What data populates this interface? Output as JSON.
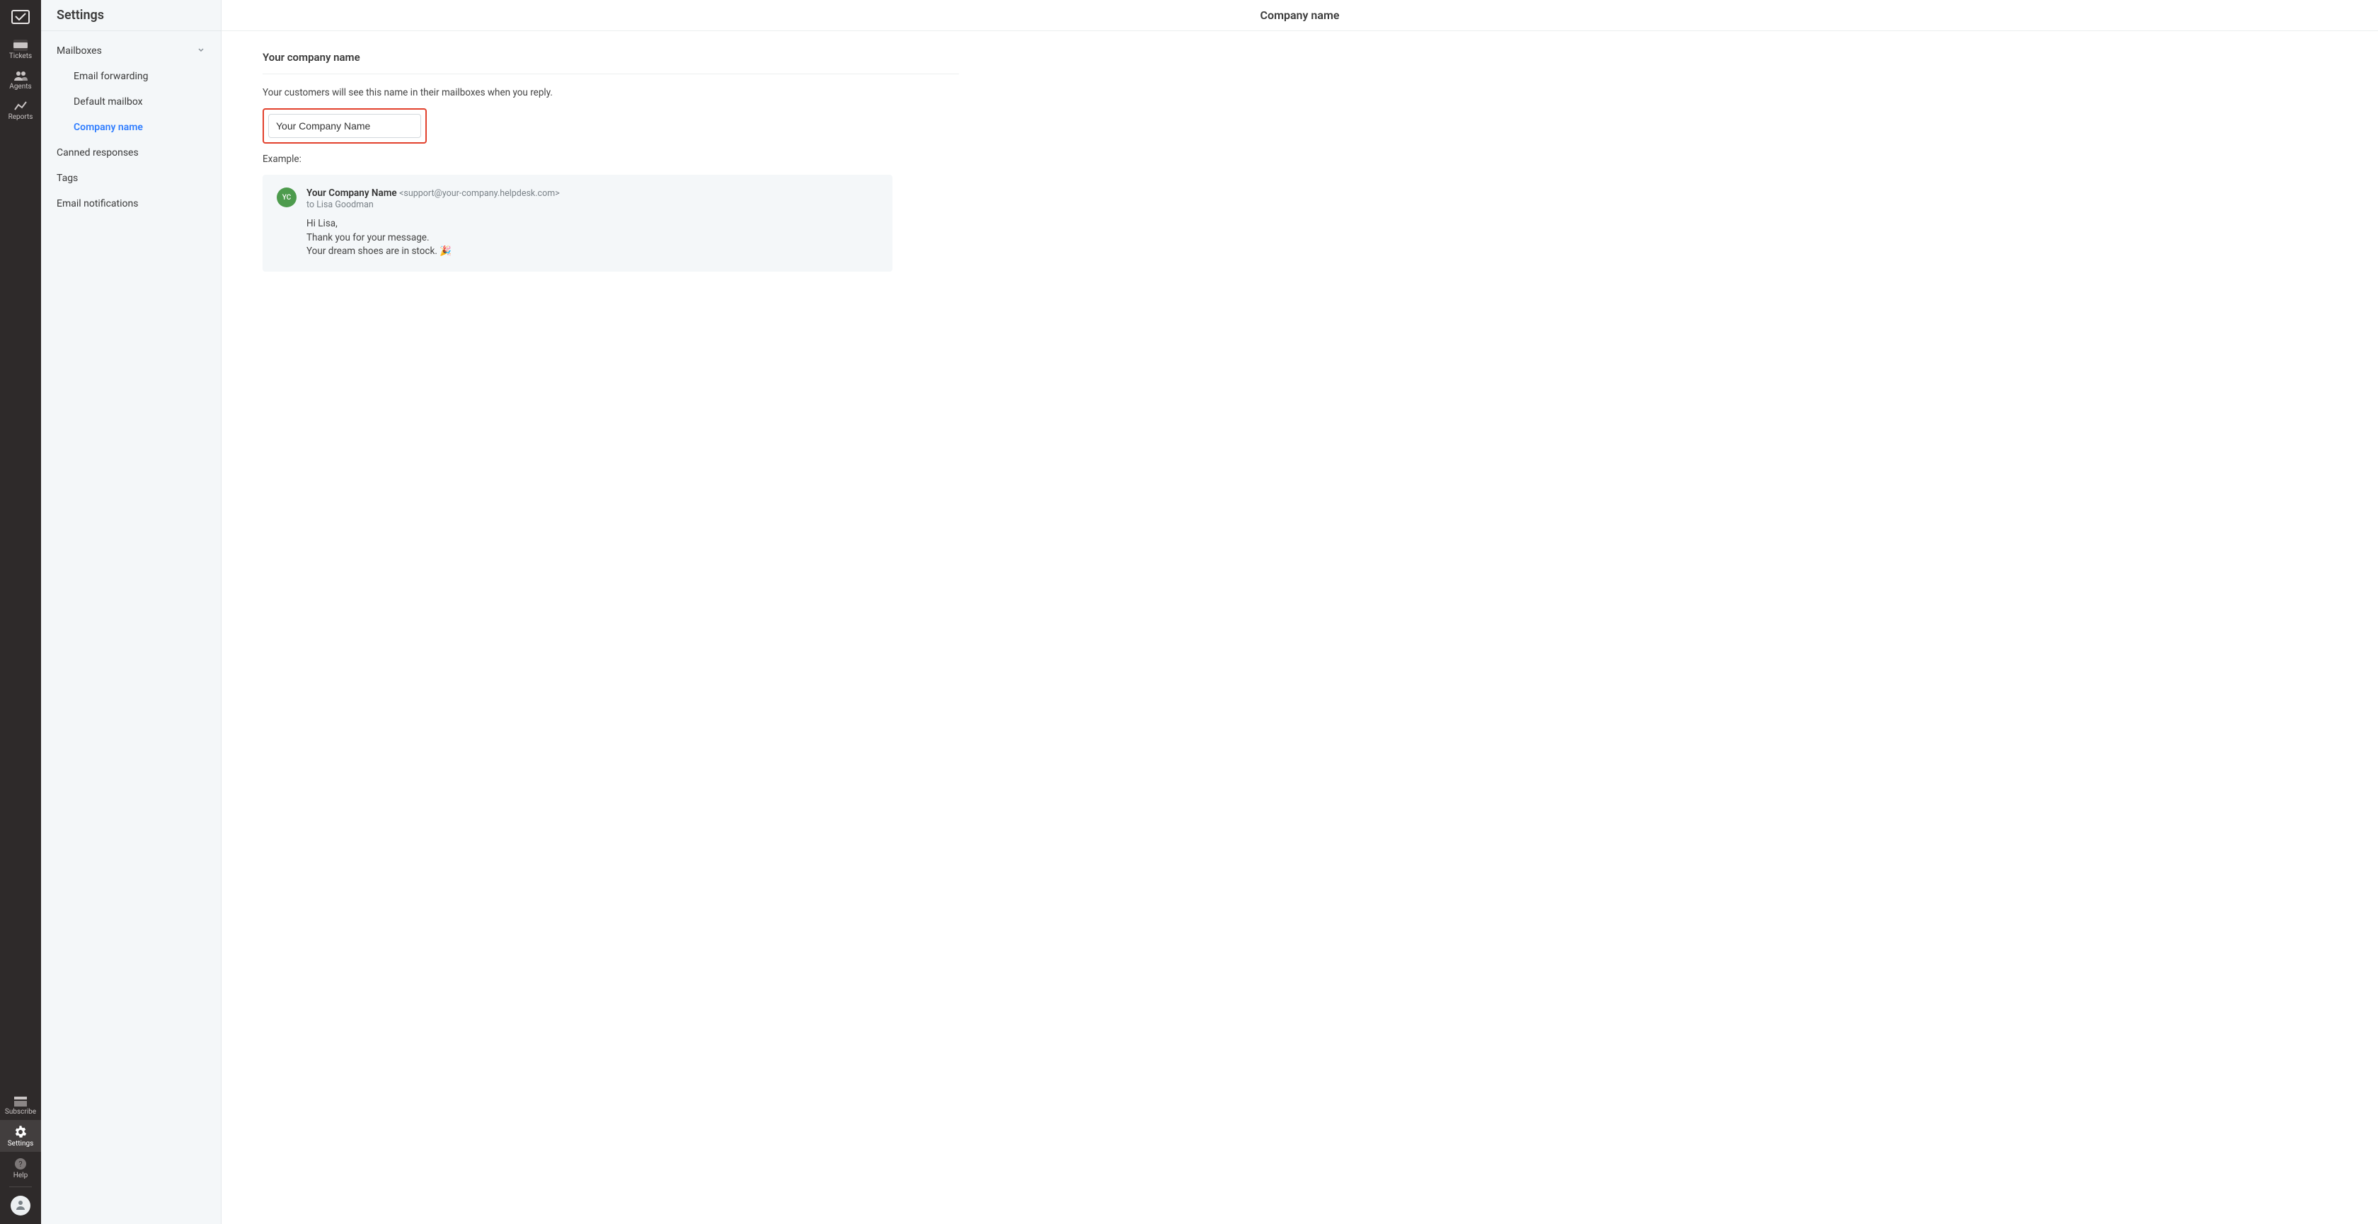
{
  "rail": {
    "items": [
      {
        "id": "tickets",
        "label": "Tickets"
      },
      {
        "id": "agents",
        "label": "Agents"
      },
      {
        "id": "reports",
        "label": "Reports"
      }
    ],
    "bottom": [
      {
        "id": "subscribe",
        "label": "Subscribe"
      },
      {
        "id": "settings",
        "label": "Settings"
      },
      {
        "id": "help",
        "label": "Help"
      }
    ]
  },
  "sidebar": {
    "title": "Settings",
    "group": {
      "label": "Mailboxes"
    },
    "subitems": [
      {
        "label": "Email forwarding"
      },
      {
        "label": "Default mailbox"
      },
      {
        "label": "Company name"
      }
    ],
    "items": [
      {
        "label": "Canned responses"
      },
      {
        "label": "Tags"
      },
      {
        "label": "Email notifications"
      }
    ]
  },
  "header": {
    "title": "Company name"
  },
  "section": {
    "title": "Your company name",
    "description": "Your customers will see this name in their mailboxes when you reply.",
    "input_value": "Your Company Name",
    "example_label": "Example:"
  },
  "example": {
    "avatar_initials": "YC",
    "from_name": "Your Company Name",
    "from_email": "<support@your-company.helpdesk.com>",
    "to_line": "to Lisa Goodman",
    "line1": "Hi Lisa,",
    "line2": "Thank you for your message.",
    "line3_prefix": "Your dream shoes are in stock. ",
    "line3_emoji": "🎉"
  }
}
